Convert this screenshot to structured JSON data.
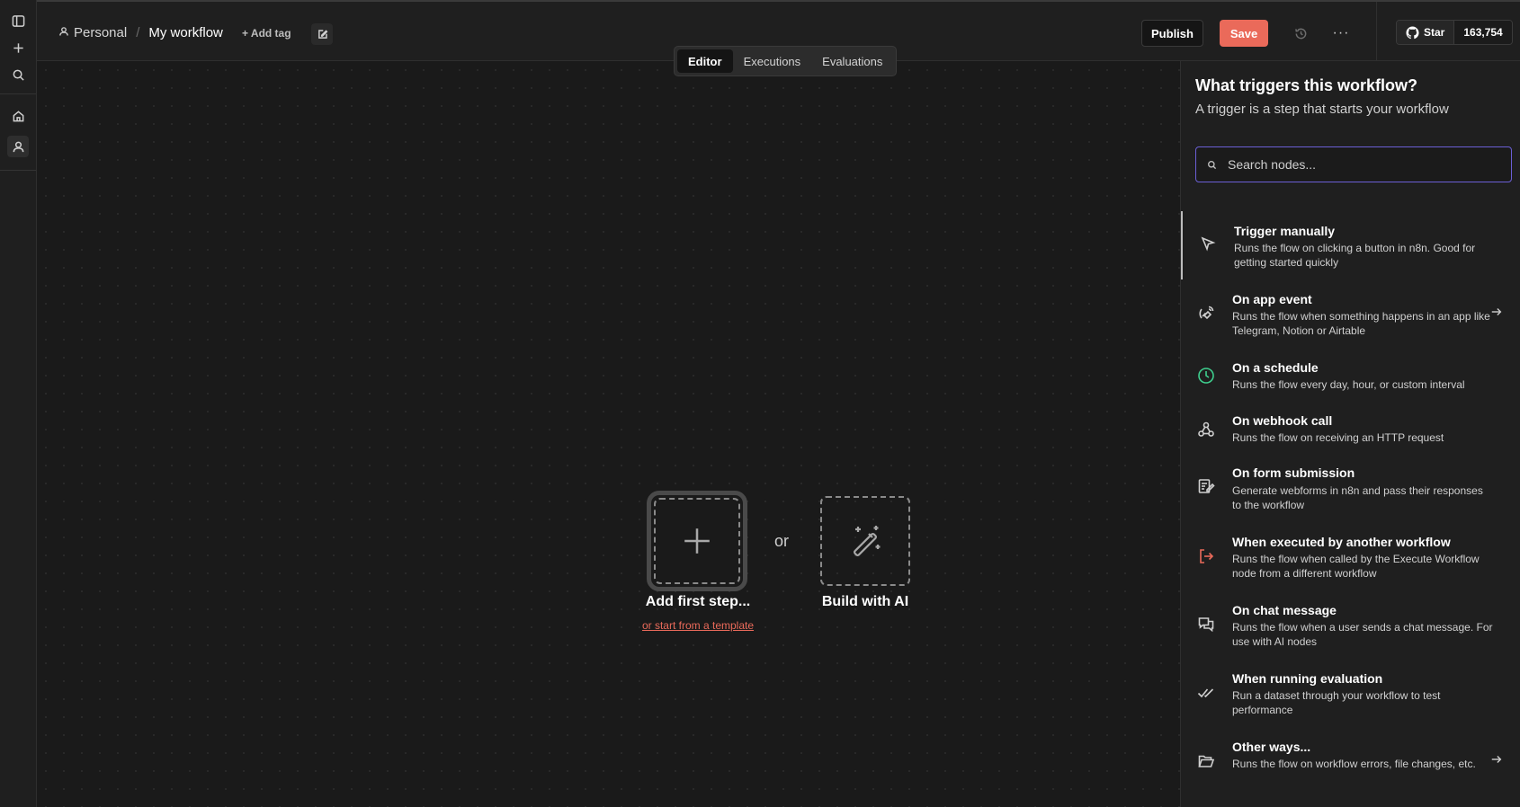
{
  "header": {
    "breadcrumb_personal": "Personal",
    "breadcrumb_sep": "/",
    "workflow_title": "My workflow",
    "add_tag": "+ Add tag",
    "publish": "Publish",
    "save": "Save",
    "more": "···",
    "github_star": "Star",
    "github_count": "163,754"
  },
  "tabs": [
    {
      "label": "Editor",
      "active": true
    },
    {
      "label": "Executions",
      "active": false
    },
    {
      "label": "Evaluations",
      "active": false
    }
  ],
  "canvas": {
    "add_first_step": "Add first step...",
    "or": "or",
    "template_link": "or start from a template",
    "build_with_ai": "Build with AI"
  },
  "panel": {
    "title": "What triggers this workflow?",
    "subtitle": "A trigger is a step that starts your workflow",
    "search_placeholder": "Search nodes...",
    "items": [
      {
        "title": "Trigger manually",
        "desc": "Runs the flow on clicking a button in n8n. Good for getting started quickly",
        "icon": "cursor-icon"
      },
      {
        "title": "On app event",
        "desc": "Runs the flow when something happens in an app like Telegram, Notion or Airtable",
        "icon": "satellite-icon"
      },
      {
        "title": "On a schedule",
        "desc": "Runs the flow every day, hour, or custom interval",
        "icon": "clock-icon"
      },
      {
        "title": "On webhook call",
        "desc": "Runs the flow on receiving an HTTP request",
        "icon": "webhook-icon"
      },
      {
        "title": "On form submission",
        "desc": "Generate webforms in n8n and pass their responses to the workflow",
        "icon": "form-icon"
      },
      {
        "title": "When executed by another workflow",
        "desc": "Runs the flow when called by the Execute Workflow node from a different workflow",
        "icon": "sign-in-icon"
      },
      {
        "title": "On chat message",
        "desc": "Runs the flow when a user sends a chat message. For use with AI nodes",
        "icon": "chat-icon"
      },
      {
        "title": "When running evaluation",
        "desc": "Run a dataset through your workflow to test performance",
        "icon": "check-double-icon"
      },
      {
        "title": "Other ways...",
        "desc": "Runs the flow on workflow errors, file changes, etc.",
        "icon": "folder-open-icon"
      }
    ]
  },
  "colors": {
    "accent": "#ea6a5a",
    "search_border": "#6b5fd6",
    "schedule_icon": "#3ecf8e"
  }
}
